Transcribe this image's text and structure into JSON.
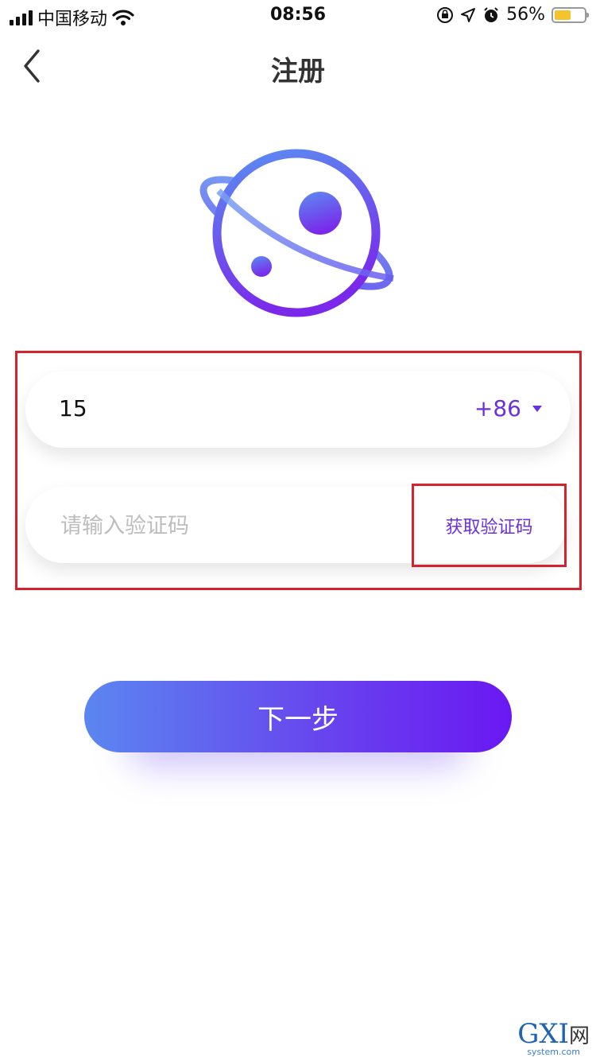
{
  "status_bar": {
    "carrier": "中国移动",
    "time": "08:56",
    "battery_percent": "56%",
    "battery_level": 0.56,
    "icons": [
      "signal-icon",
      "wifi-icon",
      "orientation-lock-icon",
      "location-icon",
      "alarm-icon",
      "battery-icon"
    ]
  },
  "nav": {
    "title": "注册",
    "back_icon": "chevron-left-icon"
  },
  "logo": {
    "icon": "planet-logo-icon",
    "colors": {
      "gradient_start": "#5a8ef2",
      "gradient_end": "#7a28ea"
    }
  },
  "form": {
    "phone_value": "15",
    "country_code": "+86",
    "code_placeholder": "请输入验证码",
    "get_code_label": "获取验证码"
  },
  "next_button": {
    "label": "下一步"
  },
  "watermark": {
    "main": "GXI",
    "cn": "网",
    "domain": "system.com"
  },
  "colors": {
    "accent": "#6a2fe0",
    "highlight_border": "#d3232c",
    "button_gradient_start": "#5b86f0",
    "button_gradient_end": "#6a18f2"
  }
}
